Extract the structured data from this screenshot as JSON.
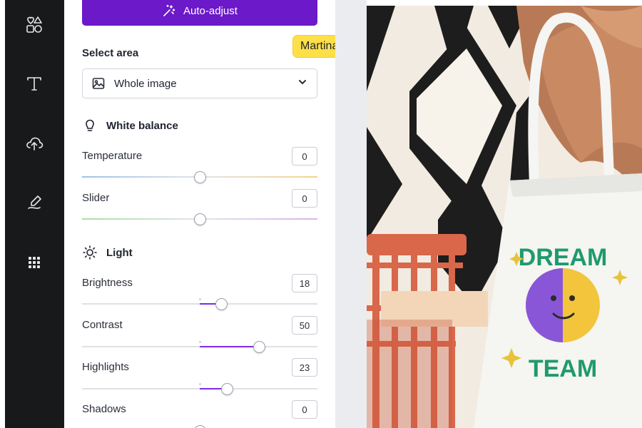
{
  "toolbar": {
    "auto_adjust_label": "Auto-adjust"
  },
  "collaborator": {
    "name": "Martina"
  },
  "select_area": {
    "label": "Select area",
    "value": "Whole image"
  },
  "white_balance": {
    "title": "White balance",
    "controls": [
      {
        "label": "Temperature",
        "value": "0",
        "fraction": 0.5
      },
      {
        "label": "Slider",
        "value": "0",
        "fraction": 0.5
      }
    ]
  },
  "light": {
    "title": "Light",
    "controls": [
      {
        "label": "Brightness",
        "value": "18",
        "fraction": 0.59
      },
      {
        "label": "Contrast",
        "value": "50",
        "fraction": 0.75
      },
      {
        "label": "Highlights",
        "value": "23",
        "fraction": 0.615
      },
      {
        "label": "Shadows",
        "value": "0",
        "fraction": 0.5
      }
    ]
  },
  "colors": {
    "accent": "#7d2ae8",
    "button": "#6b19c9",
    "rail": "#18191b",
    "tag": "#fde047"
  },
  "rail_icons": [
    "elements-icon",
    "text-icon",
    "upload-icon",
    "draw-icon",
    "apps-icon"
  ],
  "photo": {
    "bag_text_top": "DREAM",
    "bag_text_bottom": "TEAM"
  }
}
